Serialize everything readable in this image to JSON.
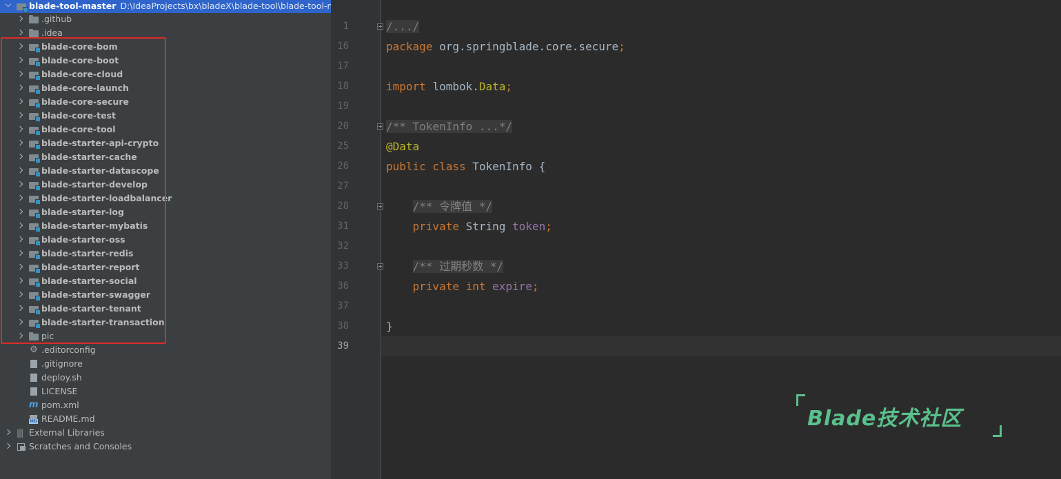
{
  "project_tree": {
    "root": {
      "name": "blade-tool-master",
      "path": "D:\\IdeaProjects\\bx\\bladeX\\blade-tool\\blade-tool-master"
    },
    "items": [
      {
        "label": ".github",
        "kind": "folder",
        "bold": false
      },
      {
        "label": ".idea",
        "kind": "folder",
        "bold": false
      },
      {
        "label": "blade-core-bom",
        "kind": "module",
        "bold": true
      },
      {
        "label": "blade-core-boot",
        "kind": "module",
        "bold": true
      },
      {
        "label": "blade-core-cloud",
        "kind": "module",
        "bold": true
      },
      {
        "label": "blade-core-launch",
        "kind": "module",
        "bold": true
      },
      {
        "label": "blade-core-secure",
        "kind": "module",
        "bold": true
      },
      {
        "label": "blade-core-test",
        "kind": "module",
        "bold": true
      },
      {
        "label": "blade-core-tool",
        "kind": "module",
        "bold": true
      },
      {
        "label": "blade-starter-api-crypto",
        "kind": "module",
        "bold": true
      },
      {
        "label": "blade-starter-cache",
        "kind": "module",
        "bold": true
      },
      {
        "label": "blade-starter-datascope",
        "kind": "module",
        "bold": true
      },
      {
        "label": "blade-starter-develop",
        "kind": "module",
        "bold": true
      },
      {
        "label": "blade-starter-loadbalancer",
        "kind": "module",
        "bold": true
      },
      {
        "label": "blade-starter-log",
        "kind": "module",
        "bold": true
      },
      {
        "label": "blade-starter-mybatis",
        "kind": "module",
        "bold": true
      },
      {
        "label": "blade-starter-oss",
        "kind": "module",
        "bold": true
      },
      {
        "label": "blade-starter-redis",
        "kind": "module",
        "bold": true
      },
      {
        "label": "blade-starter-report",
        "kind": "module",
        "bold": true
      },
      {
        "label": "blade-starter-social",
        "kind": "module",
        "bold": true
      },
      {
        "label": "blade-starter-swagger",
        "kind": "module",
        "bold": true
      },
      {
        "label": "blade-starter-tenant",
        "kind": "module",
        "bold": true
      },
      {
        "label": "blade-starter-transaction",
        "kind": "module",
        "bold": true
      },
      {
        "label": "pic",
        "kind": "folder",
        "bold": false
      },
      {
        "label": ".editorconfig",
        "kind": "gear-file",
        "bold": false
      },
      {
        "label": ".gitignore",
        "kind": "text-file",
        "bold": false
      },
      {
        "label": "deploy.sh",
        "kind": "shell-file",
        "bold": false
      },
      {
        "label": "LICENSE",
        "kind": "text-file",
        "bold": false
      },
      {
        "label": "pom.xml",
        "kind": "maven-file",
        "bold": false
      },
      {
        "label": "README.md",
        "kind": "markdown-file",
        "bold": false
      }
    ],
    "bottom_items": [
      {
        "label": "External Libraries",
        "kind": "libraries"
      },
      {
        "label": "Scratches and Consoles",
        "kind": "scratches"
      }
    ]
  },
  "editor": {
    "current_line": "39",
    "lines": [
      {
        "no": "1",
        "fold": true,
        "tokens": [
          {
            "t": "/.../",
            "c": "cmt"
          }
        ]
      },
      {
        "no": "16",
        "fold": false,
        "tokens": [
          {
            "t": "package ",
            "c": "kw"
          },
          {
            "t": "org.springblade.core.secure",
            "c": "cls"
          },
          {
            "t": ";",
            "c": "kw"
          }
        ]
      },
      {
        "no": "17",
        "fold": false,
        "tokens": []
      },
      {
        "no": "18",
        "fold": false,
        "tokens": [
          {
            "t": "import ",
            "c": "kw"
          },
          {
            "t": "lombok.",
            "c": "cls"
          },
          {
            "t": "Data",
            "c": "ann"
          },
          {
            "t": ";",
            "c": "kw"
          }
        ]
      },
      {
        "no": "19",
        "fold": false,
        "tokens": []
      },
      {
        "no": "20",
        "fold": true,
        "tokens": [
          {
            "t": "/** TokenInfo ...*/",
            "c": "cmt"
          }
        ]
      },
      {
        "no": "25",
        "fold": false,
        "tokens": [
          {
            "t": "@Data",
            "c": "ann"
          }
        ]
      },
      {
        "no": "26",
        "fold": false,
        "tokens": [
          {
            "t": "public class ",
            "c": "kw"
          },
          {
            "t": "TokenInfo {",
            "c": "cls"
          }
        ]
      },
      {
        "no": "27",
        "fold": false,
        "tokens": []
      },
      {
        "no": "28",
        "fold": true,
        "tokens": [
          {
            "t": "    ",
            "c": "cls"
          },
          {
            "t": "/** 令牌值 */",
            "c": "cmt"
          }
        ]
      },
      {
        "no": "31",
        "fold": false,
        "tokens": [
          {
            "t": "    private ",
            "c": "kw"
          },
          {
            "t": "String ",
            "c": "cls"
          },
          {
            "t": "token",
            "c": "fld"
          },
          {
            "t": ";",
            "c": "kw"
          }
        ]
      },
      {
        "no": "32",
        "fold": false,
        "tokens": []
      },
      {
        "no": "33",
        "fold": true,
        "tokens": [
          {
            "t": "    ",
            "c": "cls"
          },
          {
            "t": "/** 过期秒数 */",
            "c": "cmt"
          }
        ]
      },
      {
        "no": "36",
        "fold": false,
        "tokens": [
          {
            "t": "    private int ",
            "c": "kw"
          },
          {
            "t": "expire",
            "c": "fld"
          },
          {
            "t": ";",
            "c": "kw"
          }
        ]
      },
      {
        "no": "37",
        "fold": false,
        "tokens": []
      },
      {
        "no": "38",
        "fold": false,
        "tokens": [
          {
            "t": "}",
            "c": "cls"
          }
        ]
      },
      {
        "no": "39",
        "fold": false,
        "tokens": []
      }
    ]
  },
  "watermark": {
    "text": "Blade技术社区",
    "color": "#5ac08c"
  },
  "colors": {
    "highlight_box": "#e02a2a",
    "selection": "#2f65ca",
    "keyword": "#cc7832",
    "annotation": "#bbb529",
    "field": "#9876aa"
  }
}
